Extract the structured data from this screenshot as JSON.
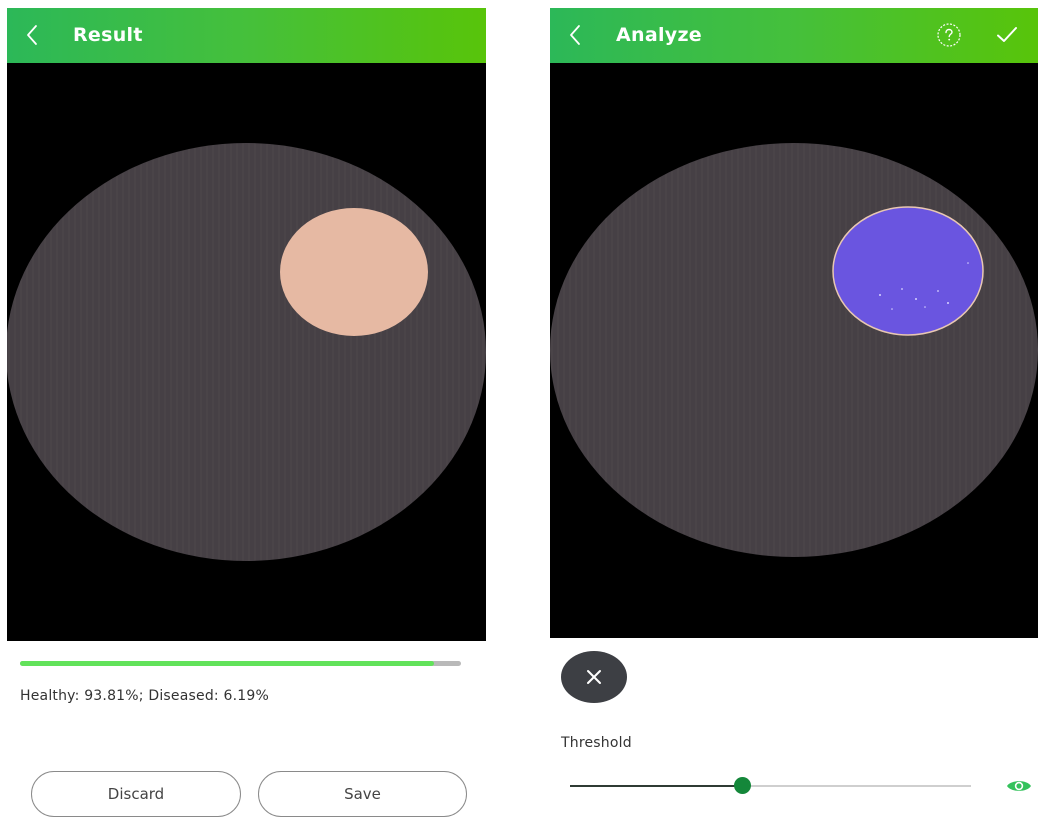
{
  "result_screen": {
    "title": "Result",
    "progress_fraction": 0.938,
    "summary_text": "Healthy: 93.81%; Diseased: 6.19%",
    "discard_label": "Discard",
    "save_label": "Save",
    "icons": {
      "back": "chevron-left-icon"
    },
    "colors": {
      "disc": "#464045",
      "lesion": "#e6b9a3",
      "progress": "#62e25a"
    }
  },
  "analyze_screen": {
    "title": "Analyze",
    "threshold_label": "Threshold",
    "threshold_fraction": 0.43,
    "icons": {
      "back": "chevron-left-icon",
      "help": "question-circle-icon",
      "confirm": "check-icon",
      "close": "close-icon",
      "visibility": "eye-icon"
    },
    "colors": {
      "disc": "#464045",
      "lesion_mask": "#6a55e0",
      "slider_thumb": "#14873a"
    }
  },
  "theme": {
    "appbar_start": "#2cb858",
    "appbar_end": "#58c40a"
  }
}
